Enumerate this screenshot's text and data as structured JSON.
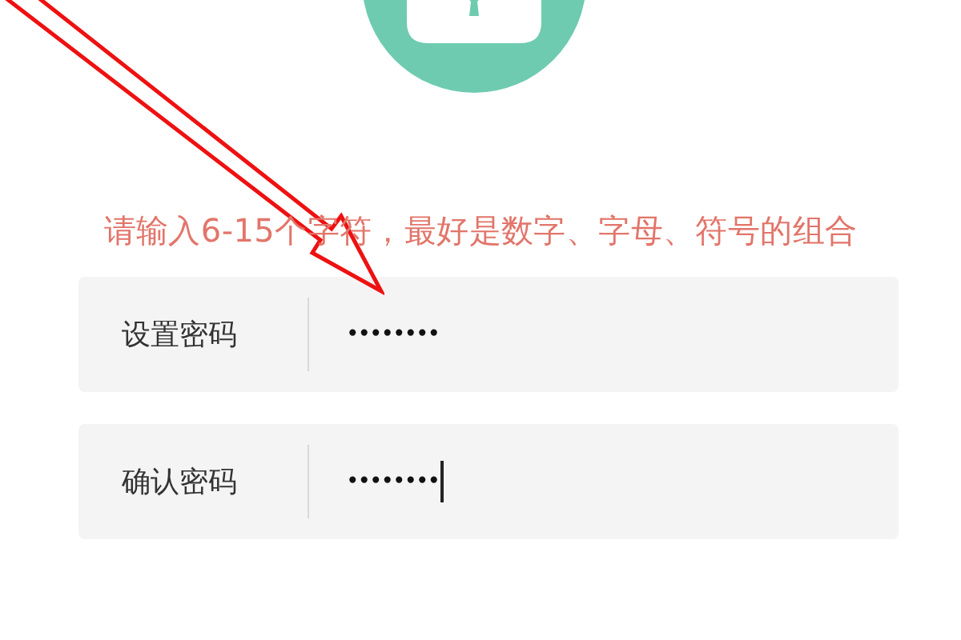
{
  "hint": "请输入6-15个字符，最好是数字、字母、符号的组合",
  "fields": [
    {
      "label": "设置密码",
      "value": "••••••••",
      "focused": false
    },
    {
      "label": "确认密码",
      "value": "••••••••",
      "focused": true
    }
  ]
}
